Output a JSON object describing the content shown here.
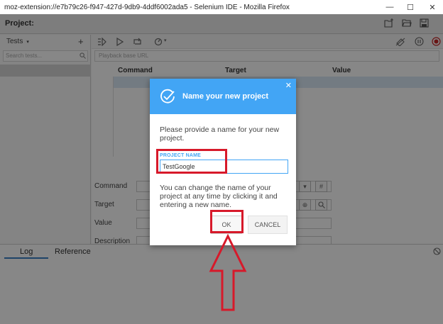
{
  "window": {
    "title": "moz-extension://e7b79c26-f947-427d-9db9-4ddf6002ada5 - Selenium IDE - Mozilla Firefox"
  },
  "project": {
    "label": "Project:"
  },
  "sidebar": {
    "tests_label": "Tests",
    "add_label": "+",
    "search_placeholder": "Search tests..."
  },
  "main": {
    "url_placeholder": "Playback base URL",
    "columns": [
      "Command",
      "Target",
      "Value"
    ]
  },
  "editor": {
    "labels": [
      "Command",
      "Target",
      "Value",
      "Description"
    ]
  },
  "bottom_tabs": [
    "Log",
    "Reference"
  ],
  "dialog": {
    "title": "Name your new project",
    "description": "Please provide a name for your new project.",
    "field_label": "PROJECT NAME",
    "field_value": "TestGoogle",
    "note": "You can change the name of your project at any time by clicking it and entering a new name.",
    "ok_label": "OK",
    "cancel_label": "CANCEL"
  },
  "colors": {
    "accent": "#42a5f5",
    "highlight": "#d7192a",
    "overlay": "rgba(0,0,0,0.47)"
  }
}
